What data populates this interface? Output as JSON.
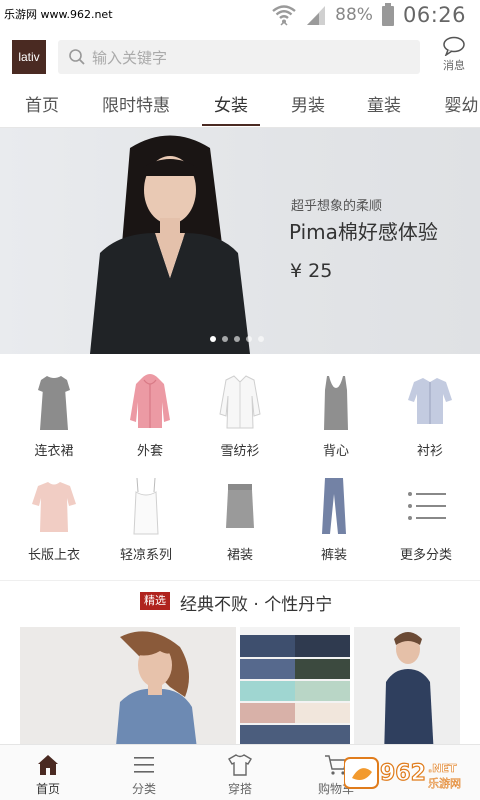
{
  "status_bar": {
    "watermark": "乐游网 www.962.net",
    "battery": "88%",
    "time": "06:26"
  },
  "header": {
    "logo_text": "lativ",
    "search_placeholder": "输入关键字",
    "message_label": "消息"
  },
  "nav": {
    "tabs": [
      {
        "label": "首页"
      },
      {
        "label": "限时特惠"
      },
      {
        "label": "女装",
        "active": true
      },
      {
        "label": "男装"
      },
      {
        "label": "童装"
      },
      {
        "label": "婴幼"
      }
    ]
  },
  "banner": {
    "subtitle": "超乎想象的柔顺",
    "title": "Pima棉好感体验",
    "price": "¥ 25",
    "slide_count": 5,
    "active_slide": 1
  },
  "categories": [
    {
      "label": "连衣裙",
      "icon": "dress-icon"
    },
    {
      "label": "外套",
      "icon": "hoodie-icon"
    },
    {
      "label": "雪纺衫",
      "icon": "chiffon-shirt-icon"
    },
    {
      "label": "背心",
      "icon": "tank-top-icon"
    },
    {
      "label": "衬衫",
      "icon": "shirt-icon"
    },
    {
      "label": "长版上衣",
      "icon": "long-top-icon"
    },
    {
      "label": "轻凉系列",
      "icon": "camisole-icon"
    },
    {
      "label": "裙装",
      "icon": "skirt-icon"
    },
    {
      "label": "裤装",
      "icon": "pants-icon"
    },
    {
      "label": "更多分类",
      "icon": "more-list-icon"
    }
  ],
  "featured": {
    "badge": "精选",
    "title": "经典不败 · 个性丹宁"
  },
  "bottom_nav": [
    {
      "label": "首页",
      "icon": "home-icon",
      "active": true
    },
    {
      "label": "分类",
      "icon": "category-icon"
    },
    {
      "label": "穿搭",
      "icon": "outfit-icon"
    },
    {
      "label": "购物车",
      "icon": "cart-icon"
    }
  ],
  "watermark_logo": {
    "main": "962",
    "suffix": ".NET",
    "cn": "乐游网"
  },
  "colors": {
    "brand": "#4a2a22",
    "badge": "#b0231e"
  }
}
